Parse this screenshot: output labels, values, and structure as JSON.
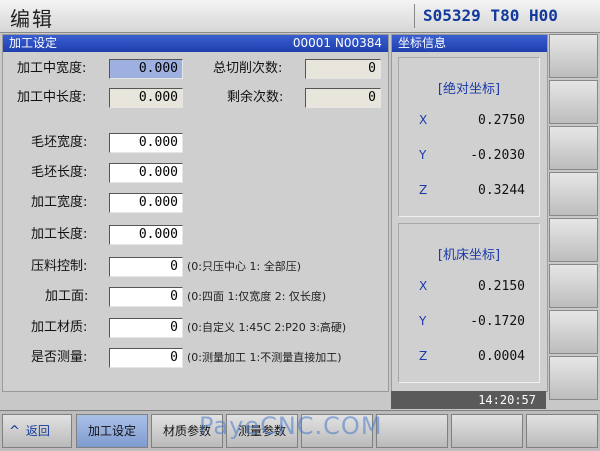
{
  "header": {
    "mode": "编辑",
    "status": "S05329 T80 H00"
  },
  "main_panel": {
    "title": "加工设定",
    "right": "00001 N00384",
    "top_rows": [
      {
        "label": "加工中宽度:",
        "value": "0.000",
        "label2": "总切削次数:",
        "value2": "0"
      },
      {
        "label": "加工中长度:",
        "value": "0.000",
        "label2": "剩余次数:",
        "value2": "0"
      }
    ],
    "params": [
      {
        "label": "毛坯宽度:",
        "value": "0.000",
        "hint": ""
      },
      {
        "label": "毛坯长度:",
        "value": "0.000",
        "hint": ""
      },
      {
        "label": "加工宽度:",
        "value": "0.000",
        "hint": ""
      },
      {
        "label": "加工长度:",
        "value": "0.000",
        "hint": ""
      },
      {
        "label": "压料控制:",
        "value": "0",
        "hint": "(0:只压中心 1: 全部压)"
      },
      {
        "label": "加工面:",
        "value": "0",
        "hint": "(0:四面 1:仅宽度 2: 仅长度)"
      },
      {
        "label": "加工材质:",
        "value": "0",
        "hint": "(0:自定义 1:45C 2:P20 3:高硬)"
      },
      {
        "label": "是否测量:",
        "value": "0",
        "hint": "(0:测量加工 1:不测量直接加工)"
      }
    ]
  },
  "coord_panel": {
    "title": "坐标信息",
    "absolute": {
      "title": "[绝对坐标]",
      "axes": [
        {
          "axis": "X",
          "value": "0.2750"
        },
        {
          "axis": "Y",
          "value": "-0.2030"
        },
        {
          "axis": "Z",
          "value": "0.3244"
        }
      ]
    },
    "machine": {
      "title": "[机床坐标]",
      "axes": [
        {
          "axis": "X",
          "value": "0.2150"
        },
        {
          "axis": "Y",
          "value": "-0.1720"
        },
        {
          "axis": "Z",
          "value": "0.0004"
        }
      ]
    },
    "time": "14:20:57"
  },
  "softkeys": {
    "back": "返回",
    "arrow": "^",
    "k1": "加工设定",
    "k2": "材质参数",
    "k3": "测量参数"
  },
  "watermark": "PayeCNC.COM",
  "colors": {
    "accent": "#1f3fae",
    "selected": "#9db0e0"
  }
}
